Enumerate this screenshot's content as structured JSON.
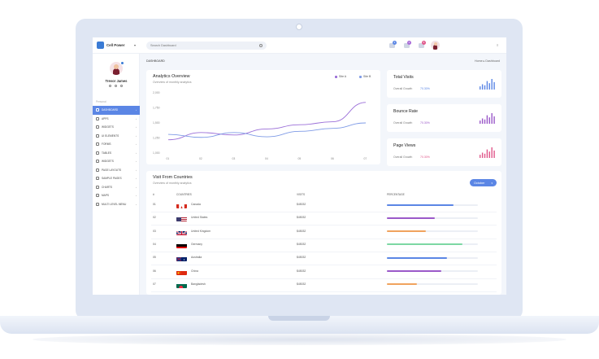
{
  "topbar": {
    "brand": "Cell Power",
    "search_placeholder": "Search Dashboard",
    "notifications": [
      {
        "icon": "mail-icon",
        "count": "4",
        "color": "#5b86e5"
      },
      {
        "icon": "cart-icon",
        "count": "2",
        "color": "#a86ad8"
      },
      {
        "icon": "bell-icon",
        "count": "6",
        "color": "#e0578a"
      }
    ],
    "more": "≡"
  },
  "sidebar": {
    "user_name": "Trevor James",
    "section_label": "Personal",
    "items": [
      {
        "label": "DASHBOARD",
        "icon": "dashboard-icon",
        "active": true
      },
      {
        "label": "APPS",
        "icon": "apps-icon"
      },
      {
        "label": "WIDGETS",
        "icon": "widgets-icon"
      },
      {
        "label": "UI ELEMENTS",
        "icon": "ui-elements-icon"
      },
      {
        "label": "FORMS",
        "icon": "forms-icon"
      },
      {
        "label": "TABLES",
        "icon": "tables-icon"
      },
      {
        "label": "WIDGETS",
        "icon": "widgets-icon"
      },
      {
        "label": "PAGE LAYOUTS",
        "icon": "layouts-icon"
      },
      {
        "label": "SAMPLE PAGES",
        "icon": "sample-pages-icon"
      },
      {
        "label": "CHARTS",
        "icon": "charts-icon"
      },
      {
        "label": "MAPS",
        "icon": "maps-icon"
      },
      {
        "label": "MULTI LEVEL MENU",
        "icon": "menu-icon"
      }
    ]
  },
  "page": {
    "title": "DASHBOARD",
    "breadcrumb": "Home  ▸  Dashboard"
  },
  "analytics": {
    "title": "Analytics Overview",
    "subtitle": "Overview of monthly analytics"
  },
  "stats": [
    {
      "title": "Total Visits",
      "label": "Overall Growth",
      "value": "70.30%",
      "color": "#5b86e5",
      "bars": [
        3,
        5,
        4,
        8,
        6,
        10,
        7
      ]
    },
    {
      "title": "Bounce Rate",
      "label": "Overall Growth",
      "value": "70.30%",
      "color": "#9b59c9",
      "bars": [
        3,
        5,
        4,
        8,
        6,
        10,
        7
      ]
    },
    {
      "title": "Page Views",
      "label": "Overall Growth",
      "value": "70.30%",
      "color": "#e0578a",
      "bars": [
        3,
        5,
        4,
        8,
        6,
        10,
        7
      ]
    }
  ],
  "countries": {
    "title": "Visit From Countries",
    "subtitle": "Overview of monthly analytics",
    "month": "October",
    "headers": {
      "num": "#",
      "country": "COUNTRIES",
      "visits": "VISITS",
      "percent": "PERCENTAGE"
    },
    "rows": [
      {
        "num": "01",
        "country": "Canada",
        "visits": "$45032",
        "flag": "ca",
        "percent": 0.73,
        "color": "#5b86e5"
      },
      {
        "num": "02",
        "country": "United States",
        "visits": "$45032",
        "flag": "us",
        "percent": 0.53,
        "color": "#9b59c9"
      },
      {
        "num": "03",
        "country": "United Kingdom",
        "visits": "$45032",
        "flag": "gb",
        "percent": 0.43,
        "color": "#f0a35e"
      },
      {
        "num": "04",
        "country": "Germany",
        "visits": "$45032",
        "flag": "de",
        "percent": 0.83,
        "color": "#7dd8a4"
      },
      {
        "num": "05",
        "country": "Australia",
        "visits": "$45032",
        "flag": "au",
        "percent": 0.66,
        "color": "#5b86e5"
      },
      {
        "num": "06",
        "country": "China",
        "visits": "$45032",
        "flag": "cn",
        "percent": 0.6,
        "color": "#9b59c9"
      },
      {
        "num": "07",
        "country": "Bangladesh",
        "visits": "$45032",
        "flag": "bd",
        "percent": 0.33,
        "color": "#f0a35e"
      }
    ]
  },
  "chart_data": {
    "type": "line",
    "title": "Analytics Overview",
    "x": [
      "01",
      "02",
      "03",
      "04",
      "05",
      "06",
      "07"
    ],
    "yticks": [
      "1,000",
      "1,250",
      "1,500",
      "1,750",
      "2,000"
    ],
    "ylim": [
      1000,
      2000
    ],
    "series": [
      {
        "name": "Site A",
        "color": "#9b6fd8",
        "values": [
          1220,
          1340,
          1300,
          1400,
          1470,
          1520,
          1840
        ]
      },
      {
        "name": "Site B",
        "color": "#7f9be6",
        "values": [
          1310,
          1260,
          1340,
          1270,
          1360,
          1410,
          1500
        ]
      }
    ]
  }
}
